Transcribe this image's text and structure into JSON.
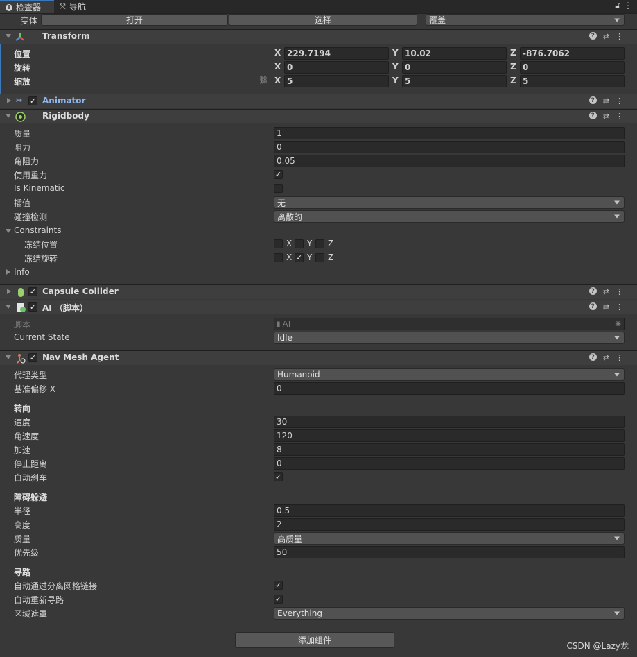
{
  "tabs": [
    {
      "label": "检查器",
      "icon": "info-icon"
    },
    {
      "label": "导航",
      "icon": "navigation-icon"
    }
  ],
  "variant": {
    "label": "变体",
    "open_button": "打开",
    "select_button": "选择",
    "overrides_dropdown": "覆盖"
  },
  "transform": {
    "title": "Transform",
    "position_label": "位置",
    "rotation_label": "旋转",
    "scale_label": "缩放",
    "position": {
      "x": "229.7194",
      "y": "10.02",
      "z": "-876.7062"
    },
    "rotation": {
      "x": "0",
      "y": "0",
      "z": "0"
    },
    "scale": {
      "x": "5",
      "y": "5",
      "z": "5"
    },
    "axis_x": "X",
    "axis_y": "Y",
    "axis_z": "Z"
  },
  "animator": {
    "title": "Animator",
    "enabled": true
  },
  "rigidbody": {
    "title": "Rigidbody",
    "mass_label": "质量",
    "mass": "1",
    "drag_label": "阻力",
    "drag": "0",
    "angular_drag_label": "角阻力",
    "angular_drag": "0.05",
    "use_gravity_label": "使用重力",
    "use_gravity": true,
    "is_kinematic_label": "Is Kinematic",
    "is_kinematic": false,
    "interpolate_label": "插值",
    "interpolate": "无",
    "collision_label": "碰撞检测",
    "collision": "离散的",
    "constraints_label": "Constraints",
    "freeze_position_label": "冻结位置",
    "freeze_rotation_label": "冻结旋转",
    "freeze_position": {
      "x": false,
      "y": false,
      "z": false
    },
    "freeze_rotation": {
      "x": false,
      "y": true,
      "z": false
    },
    "info_label": "Info"
  },
  "capsule_collider": {
    "title": "Capsule Collider",
    "enabled": true
  },
  "ai_script": {
    "title": "AI （脚本）",
    "enabled": true,
    "script_label": "脚本",
    "script_value": "AI",
    "current_state_label": "Current State",
    "current_state": "Idle"
  },
  "nav_mesh_agent": {
    "title": "Nav Mesh Agent",
    "enabled": true,
    "agent_type_label": "代理类型",
    "agent_type": "Humanoid",
    "base_offset_label": "基准偏移 X",
    "base_offset": "0",
    "steering_header": "转向",
    "speed_label": "速度",
    "speed": "30",
    "angular_speed_label": "角速度",
    "angular_speed": "120",
    "acceleration_label": "加速",
    "acceleration": "8",
    "stopping_distance_label": "停止距离",
    "stopping_distance": "0",
    "auto_braking_label": "自动刹车",
    "auto_braking": true,
    "obstacle_header": "障碍躲避",
    "radius_label": "半径",
    "radius": "0.5",
    "height_label": "高度",
    "height": "2",
    "quality_label": "质量",
    "quality": "高质量",
    "priority_label": "优先级",
    "priority": "50",
    "pathfinding_header": "寻路",
    "auto_traverse_label": "自动通过分离网格链接",
    "auto_traverse": true,
    "auto_repath_label": "自动重新寻路",
    "auto_repath": true,
    "area_mask_label": "区域遮罩",
    "area_mask": "Everything"
  },
  "add_component_button": "添加组件",
  "watermark": "CSDN @Lazy龙",
  "colors": {
    "accent": "#3a79bb",
    "background": "#383838",
    "header": "#3e3e3e",
    "animator_title": "#8fb8f0"
  }
}
